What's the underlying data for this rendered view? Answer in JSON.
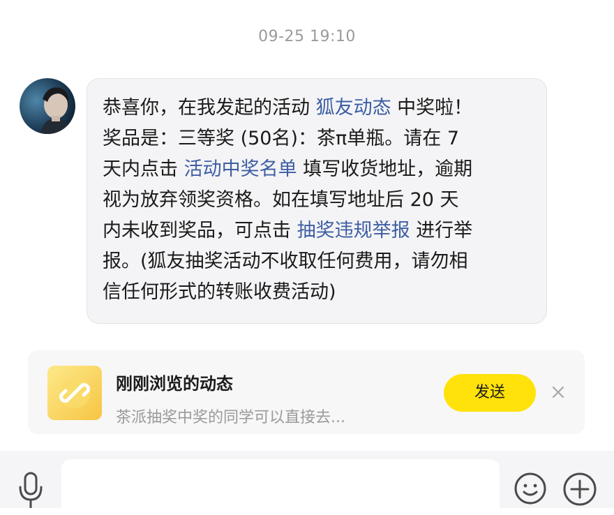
{
  "timestamp": "09-25 19:10",
  "message": {
    "line1": {
      "pre": "恭喜你，在我发起的活动 ",
      "link": "狐友动态",
      "post": " 中奖啦！"
    },
    "line2": "奖品是：三等奖 (50名)：茶π单瓶。请在 7",
    "line3": {
      "pre": "天内点击 ",
      "link": "活动中奖名单",
      "post": " 填写收货地址，逾期"
    },
    "line4": "视为放弃领奖资格。如在填写地址后 20 天",
    "line5": {
      "pre": "内未收到奖品，可点击 ",
      "link": "抽奖违规举报",
      "post": " 进行举"
    },
    "line6": "报。(狐友抽奖活动不收取任何费用，请勿相",
    "line7": "信任何形式的转账收费活动)"
  },
  "preview": {
    "title": "刚刚浏览的动态",
    "subtitle": "茶派抽奖中奖的同学可以直接去...",
    "send_label": "发送"
  },
  "input": {
    "value": ""
  },
  "colors": {
    "link": "#3d5ea3",
    "send_button": "#ffe20a",
    "bubble": "#f4f4f6"
  },
  "icons": [
    "avatar",
    "link-icon",
    "close-icon",
    "mic-icon",
    "emoji-icon",
    "plus-icon"
  ]
}
